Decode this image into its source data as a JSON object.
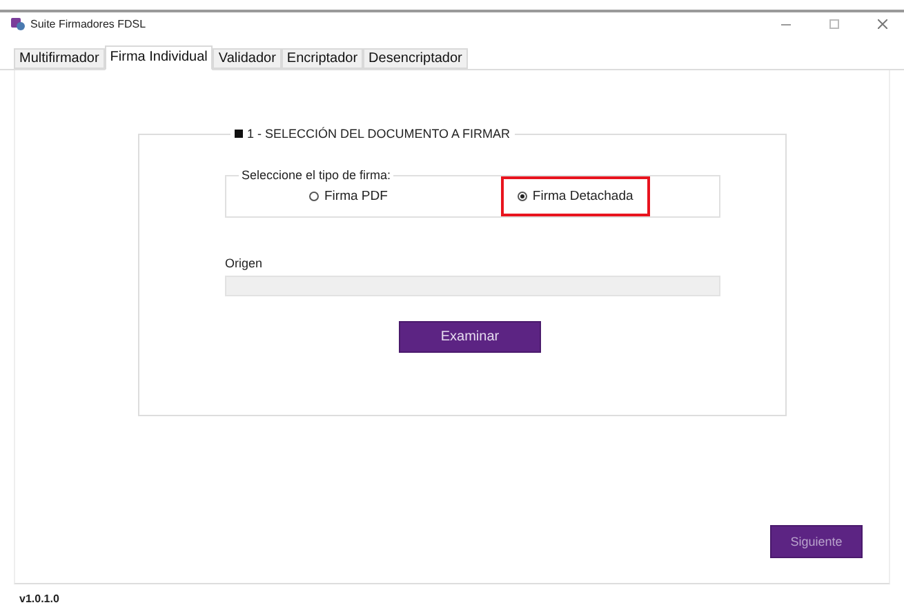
{
  "window": {
    "title": "Suite Firmadores FDSL"
  },
  "tabs": [
    {
      "label": "Multifirmador",
      "selected": false
    },
    {
      "label": "Firma Individual",
      "selected": true
    },
    {
      "label": "Validador",
      "selected": false
    },
    {
      "label": "Encriptador",
      "selected": false
    },
    {
      "label": "Desencriptador",
      "selected": false
    }
  ],
  "section": {
    "title": "1 - SELECCIÓN DEL DOCUMENTO A FIRMAR",
    "signature_type": {
      "label": "Seleccione el tipo de firma:",
      "options": [
        {
          "label": "Firma PDF",
          "selected": false,
          "highlighted": false
        },
        {
          "label": "Firma Detachada",
          "selected": true,
          "highlighted": true
        }
      ]
    },
    "origin": {
      "label": "Origen"
    },
    "browse_button": "Examinar"
  },
  "next_button": {
    "label": "Siguiente",
    "disabled": true
  },
  "version": "v1.0.1.0"
}
